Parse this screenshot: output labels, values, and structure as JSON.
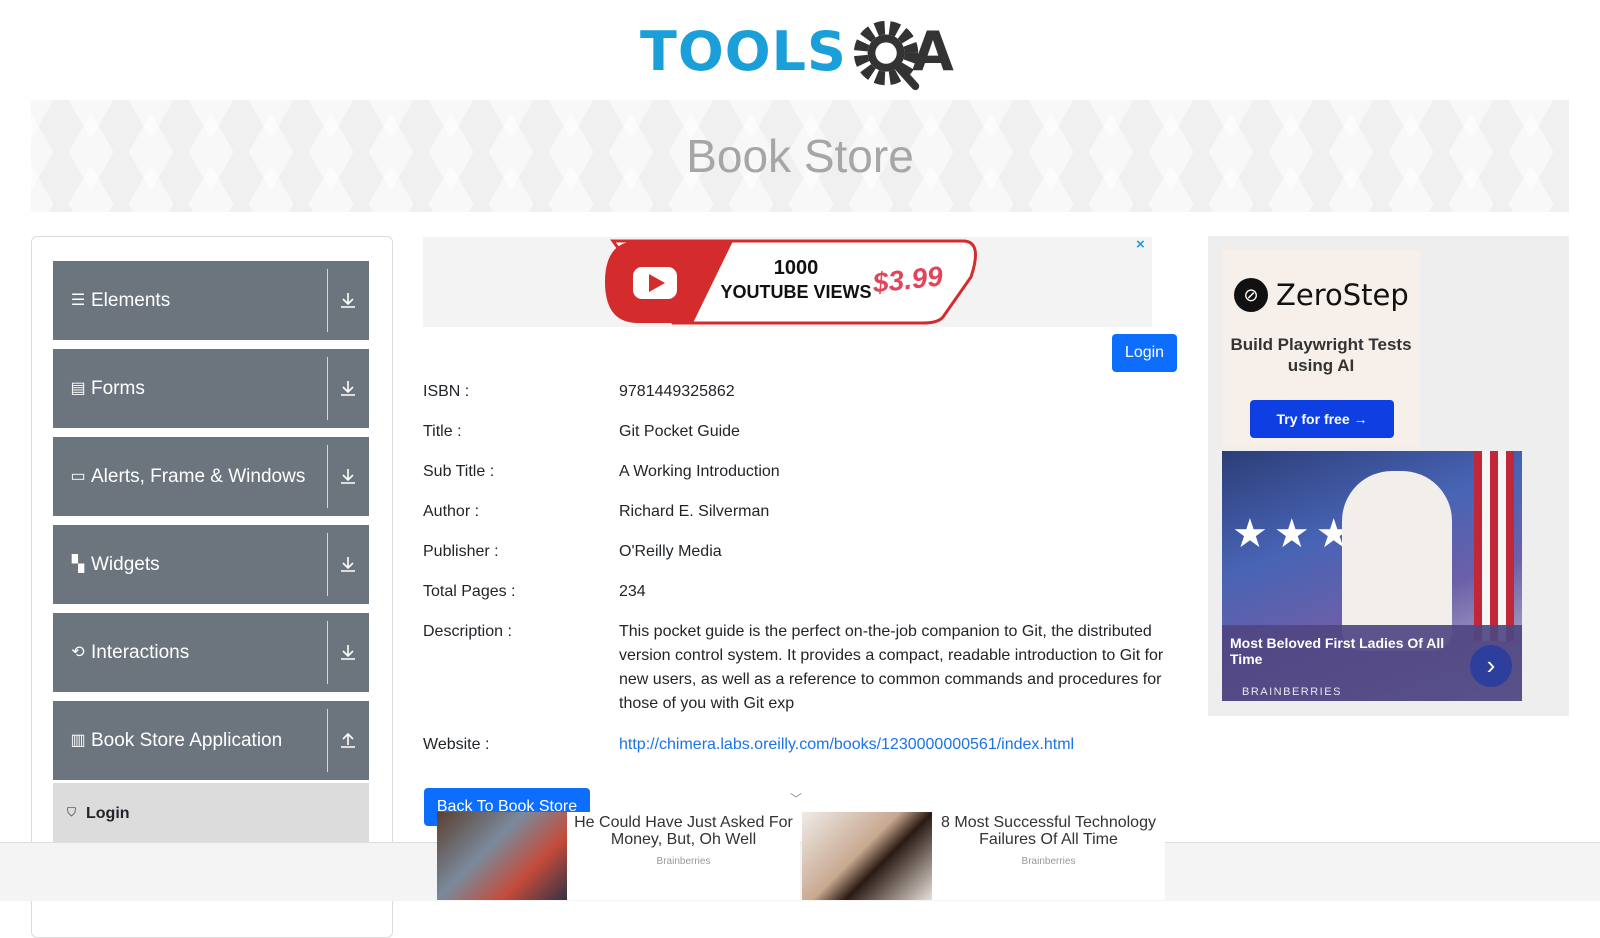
{
  "logo": {
    "text": "TOOLS",
    "tail": "A"
  },
  "banner": {
    "title": "Book Store"
  },
  "sidebar": {
    "groups": [
      {
        "label": "Elements",
        "icon": "menu-lines-icon"
      },
      {
        "label": "Forms",
        "icon": "document-icon"
      },
      {
        "label": "Alerts, Frame & Windows",
        "icon": "window-icon"
      },
      {
        "label": "Widgets",
        "icon": "widgets-icon"
      },
      {
        "label": "Interactions",
        "icon": "refresh-icon"
      },
      {
        "label": "Book Store Application",
        "icon": "library-icon"
      }
    ],
    "active_item": {
      "label": "Login",
      "icon": "html5-icon"
    }
  },
  "top_ad": {
    "line1": "1000",
    "line2": "YOUTUBE VIEWS",
    "price": "$3.99",
    "close": "×"
  },
  "actions": {
    "login": "Login",
    "back": "Back To Book Store"
  },
  "book": {
    "isbn_label": "ISBN :",
    "isbn": "9781449325862",
    "title_label": "Title :",
    "title": "Git Pocket Guide",
    "subtitle_label": "Sub Title :",
    "subtitle": "A Working Introduction",
    "author_label": "Author :",
    "author": "Richard E. Silverman",
    "publisher_label": "Publisher :",
    "publisher": "O'Reilly Media",
    "pages_label": "Total Pages :",
    "pages": "234",
    "description_label": "Description :",
    "description": "This pocket guide is the perfect on-the-job companion to Git, the distributed version control system. It provides a compact, readable introduction to Git for new users, as well as a reference to common commands and procedures for those of you with Git exp",
    "website_label": "Website :",
    "website": "http://chimera.labs.oreilly.com/books/1230000000561/index.html"
  },
  "right_ad": {
    "brand": "ZeroStep",
    "text": "Build Playwright Tests using AI",
    "cta": "Try for free →",
    "caption": "Most Beloved First Ladies Of All Time",
    "source": "BRAINBERRIES"
  },
  "bottom_ads": [
    {
      "title": "He Could Have Just Asked For Money, But, Oh Well",
      "source": "Brainberries"
    },
    {
      "title": "8 Most Successful Technology Failures Of All Time",
      "source": "Brainberries"
    }
  ]
}
